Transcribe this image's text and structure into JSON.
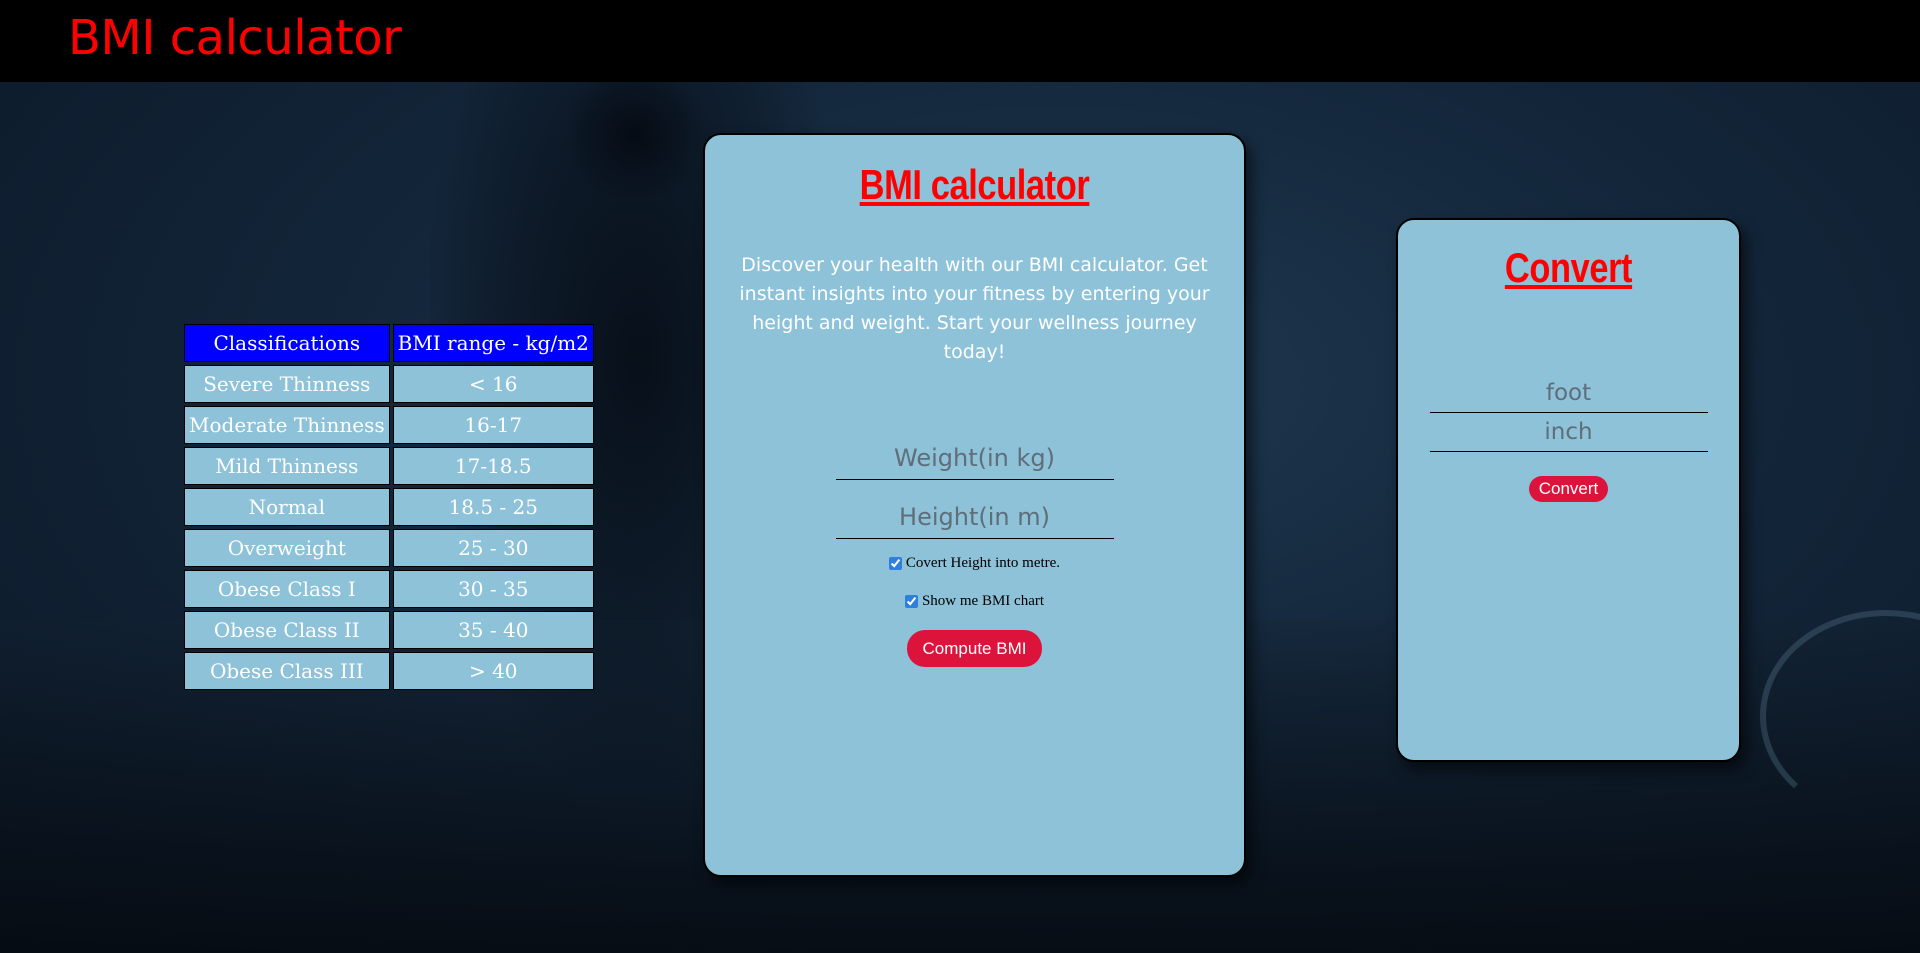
{
  "header": {
    "title": "BMI calculator"
  },
  "classification_table": {
    "headers": [
      "Classifications",
      "BMI range - kg/m2"
    ],
    "rows": [
      [
        "Severe Thinness",
        "< 16"
      ],
      [
        "Moderate Thinness",
        "16-17"
      ],
      [
        "Mild Thinness",
        "17-18.5"
      ],
      [
        "Normal",
        "18.5 - 25"
      ],
      [
        "Overweight",
        "25 - 30"
      ],
      [
        "Obese Class I",
        "30 - 35"
      ],
      [
        "Obese Class II",
        "35 - 40"
      ],
      [
        "Obese Class III",
        "> 40"
      ]
    ]
  },
  "calculator": {
    "title": "BMI calculator",
    "intro": "Discover your health with our BMI calculator. Get instant insights into your fitness by entering your height and weight. Start your wellness journey today!",
    "weight_placeholder": "Weight(in kg)",
    "height_placeholder": "Height(in m)",
    "convert_checkbox_label": "Covert Height into metre.",
    "convert_checkbox_checked": true,
    "chart_checkbox_label": "Show me BMI chart",
    "chart_checkbox_checked": true,
    "compute_label": "Compute BMI"
  },
  "converter": {
    "title": "Convert",
    "foot_placeholder": "foot",
    "inch_placeholder": "inch",
    "convert_label": "Convert"
  },
  "colors": {
    "accent_red": "#ff0000",
    "button_red": "#dc143c",
    "card_blue": "#8dc2d9",
    "table_header_blue": "#0000ff"
  }
}
